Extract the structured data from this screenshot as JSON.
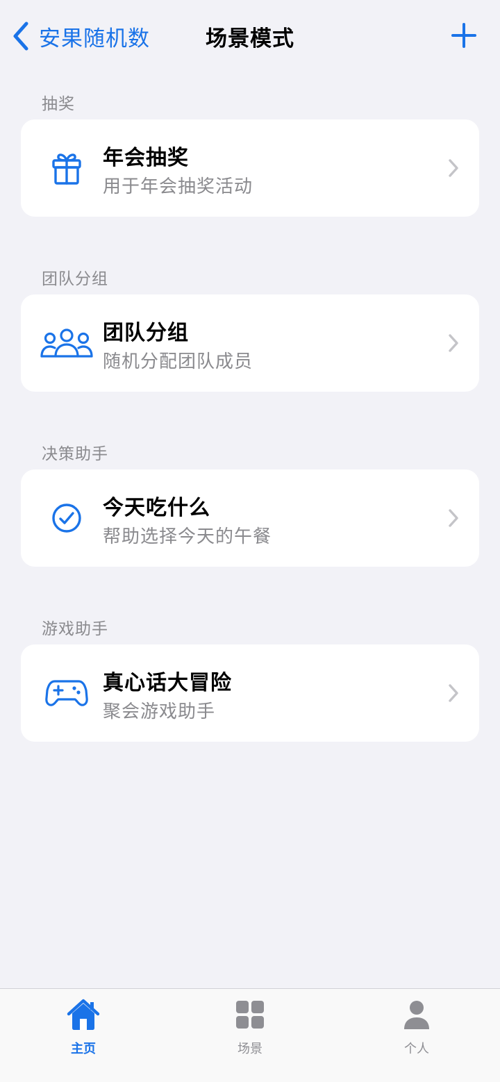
{
  "nav": {
    "back_label": "安果随机数",
    "title": "场景模式",
    "add_icon": "plus-icon"
  },
  "sections": [
    {
      "header": "抽奖",
      "card": {
        "icon": "gift-icon",
        "title": "年会抽奖",
        "subtitle": "用于年会抽奖活动"
      }
    },
    {
      "header": "团队分组",
      "card": {
        "icon": "people-group-icon",
        "title": "团队分组",
        "subtitle": "随机分配团队成员"
      }
    },
    {
      "header": "决策助手",
      "card": {
        "icon": "checkmark-circle-icon",
        "title": "今天吃什么",
        "subtitle": "帮助选择今天的午餐"
      }
    },
    {
      "header": "游戏助手",
      "card": {
        "icon": "gamepad-icon",
        "title": "真心话大冒险",
        "subtitle": "聚会游戏助手"
      }
    }
  ],
  "tabbar": {
    "tabs": [
      {
        "label": "主页",
        "icon": "home-icon",
        "active": true
      },
      {
        "label": "场景",
        "icon": "grid-icon",
        "active": false
      },
      {
        "label": "个人",
        "icon": "person-icon",
        "active": false
      }
    ]
  },
  "colors": {
    "accent": "#1a73e8",
    "background": "#f2f2f7",
    "card": "#ffffff",
    "secondary_text": "#8a8a8e",
    "inactive_tab": "#8e8e93"
  }
}
